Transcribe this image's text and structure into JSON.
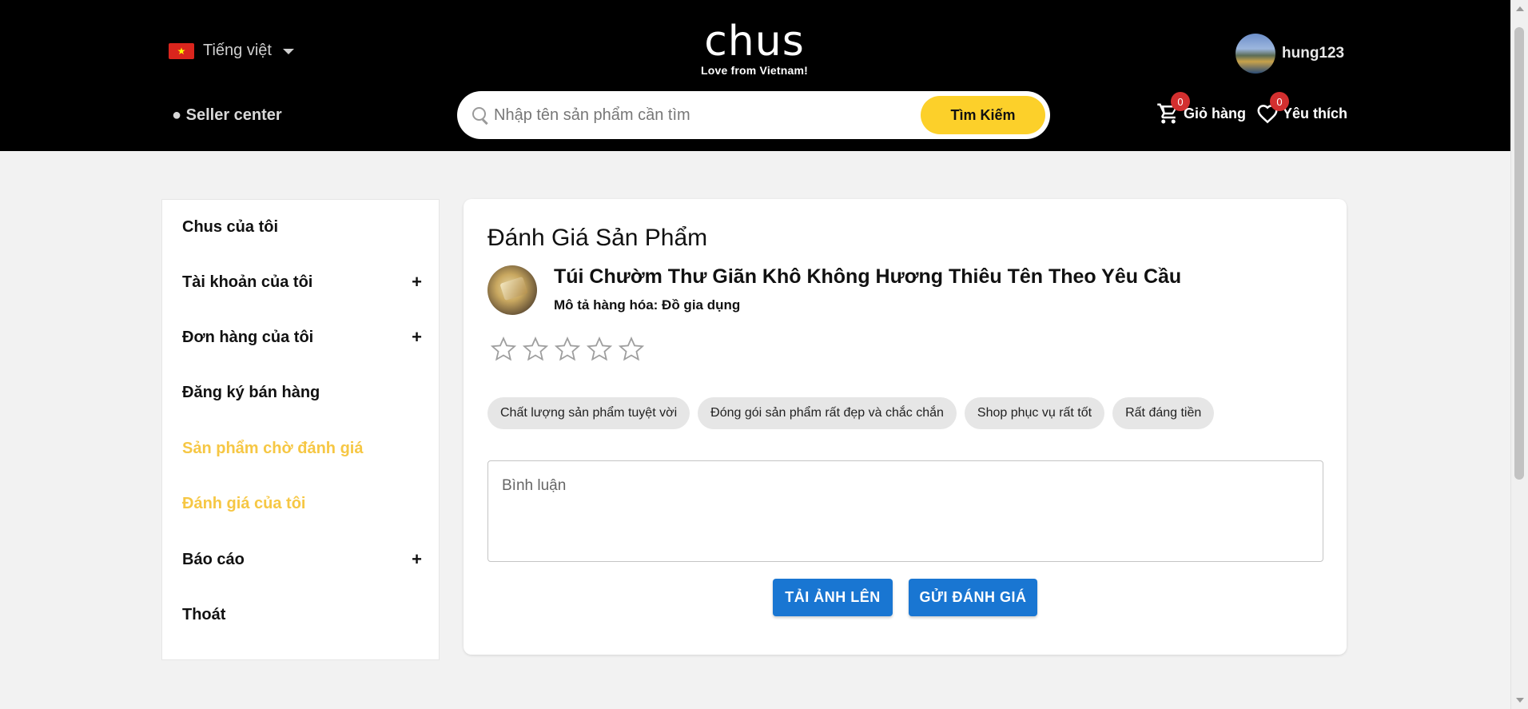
{
  "header": {
    "language": "Tiếng việt",
    "logo_text": "chus",
    "logo_tagline": "Love from Vietnam!",
    "username": "hung123",
    "seller_center": "● Seller center",
    "search": {
      "placeholder": "Nhập tên sản phẩm cần tìm",
      "button_label": "Tìm Kiếm"
    },
    "cart": {
      "label": "Giỏ hàng",
      "count": "0"
    },
    "wishlist": {
      "label": "Yêu thích",
      "count": "0"
    }
  },
  "sidebar": {
    "items": [
      {
        "label": "Chus của tôi",
        "expandable": false,
        "active": false
      },
      {
        "label": "Tài khoản của tôi",
        "expandable": true,
        "active": false
      },
      {
        "label": "Đơn hàng của tôi",
        "expandable": true,
        "active": false
      },
      {
        "label": "Đăng ký bán hàng",
        "expandable": false,
        "active": false
      },
      {
        "label": "Sản phẩm chờ đánh giá",
        "expandable": false,
        "active": true
      },
      {
        "label": "Đánh giá của tôi",
        "expandable": false,
        "active": true
      },
      {
        "label": "Báo cáo",
        "expandable": true,
        "active": false
      },
      {
        "label": "Thoát",
        "expandable": false,
        "active": false
      }
    ],
    "expand_symbol": "+"
  },
  "review": {
    "title": "Đánh Giá Sản Phẩm",
    "product_name": "Túi Chườm Thư Giãn Khô Không Hương Thiêu Tên Theo Yêu Cầu",
    "product_desc": "Mô tả hàng hóa: Đồ gia dụng",
    "rating": 0,
    "max_rating": 5,
    "tags": [
      "Chất lượng sản phẩm tuyệt vời",
      "Đóng gói sản phẩm rất đẹp và chắc chắn",
      "Shop phục vụ rất tốt",
      "Rất đáng tiền"
    ],
    "comment_placeholder": "Bình luận",
    "upload_button": "TẢI ẢNH LÊN",
    "submit_button": "GỬI ĐÁNH GIÁ"
  },
  "colors": {
    "header_bg": "#000000",
    "accent_yellow": "#fcd02a",
    "active_link": "#f6c744",
    "primary_button": "#1976d2",
    "badge": "#d32f2f"
  }
}
